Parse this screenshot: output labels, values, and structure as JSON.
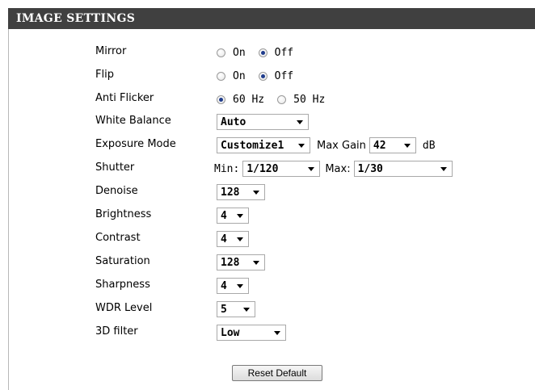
{
  "section": {
    "title": "IMAGE SETTINGS"
  },
  "mirror": {
    "label": "Mirror",
    "options": [
      "On",
      "Off"
    ],
    "selected": "Off"
  },
  "flip": {
    "label": "Flip",
    "options": [
      "On",
      "Off"
    ],
    "selected": "Off"
  },
  "anti_flicker": {
    "label": "Anti Flicker",
    "options": [
      "60 Hz",
      "50 Hz"
    ],
    "selected": "60 Hz"
  },
  "white_balance": {
    "label": "White Balance",
    "value": "Auto"
  },
  "exposure_mode": {
    "label": "Exposure Mode",
    "value": "Customize1",
    "max_gain_label": "Max Gain",
    "max_gain_value": "42",
    "max_gain_unit": "dB"
  },
  "shutter": {
    "label": "Shutter",
    "min_label": "Min:",
    "min_value": "1/120",
    "max_label": "Max:",
    "max_value": "1/30"
  },
  "denoise": {
    "label": "Denoise",
    "value": "128"
  },
  "brightness": {
    "label": "Brightness",
    "value": "4"
  },
  "contrast": {
    "label": "Contrast",
    "value": "4"
  },
  "saturation": {
    "label": "Saturation",
    "value": "128"
  },
  "sharpness": {
    "label": "Sharpness",
    "value": "4"
  },
  "wdr_level": {
    "label": "WDR Level",
    "value": "5"
  },
  "filter_3d": {
    "label": "3D filter",
    "value": "Low"
  },
  "actions": {
    "reset_label": "Reset Default"
  },
  "colors": {
    "header_bg": "#404040",
    "header_text": "#ffffff",
    "radio_dot": "#1f3c8c"
  }
}
